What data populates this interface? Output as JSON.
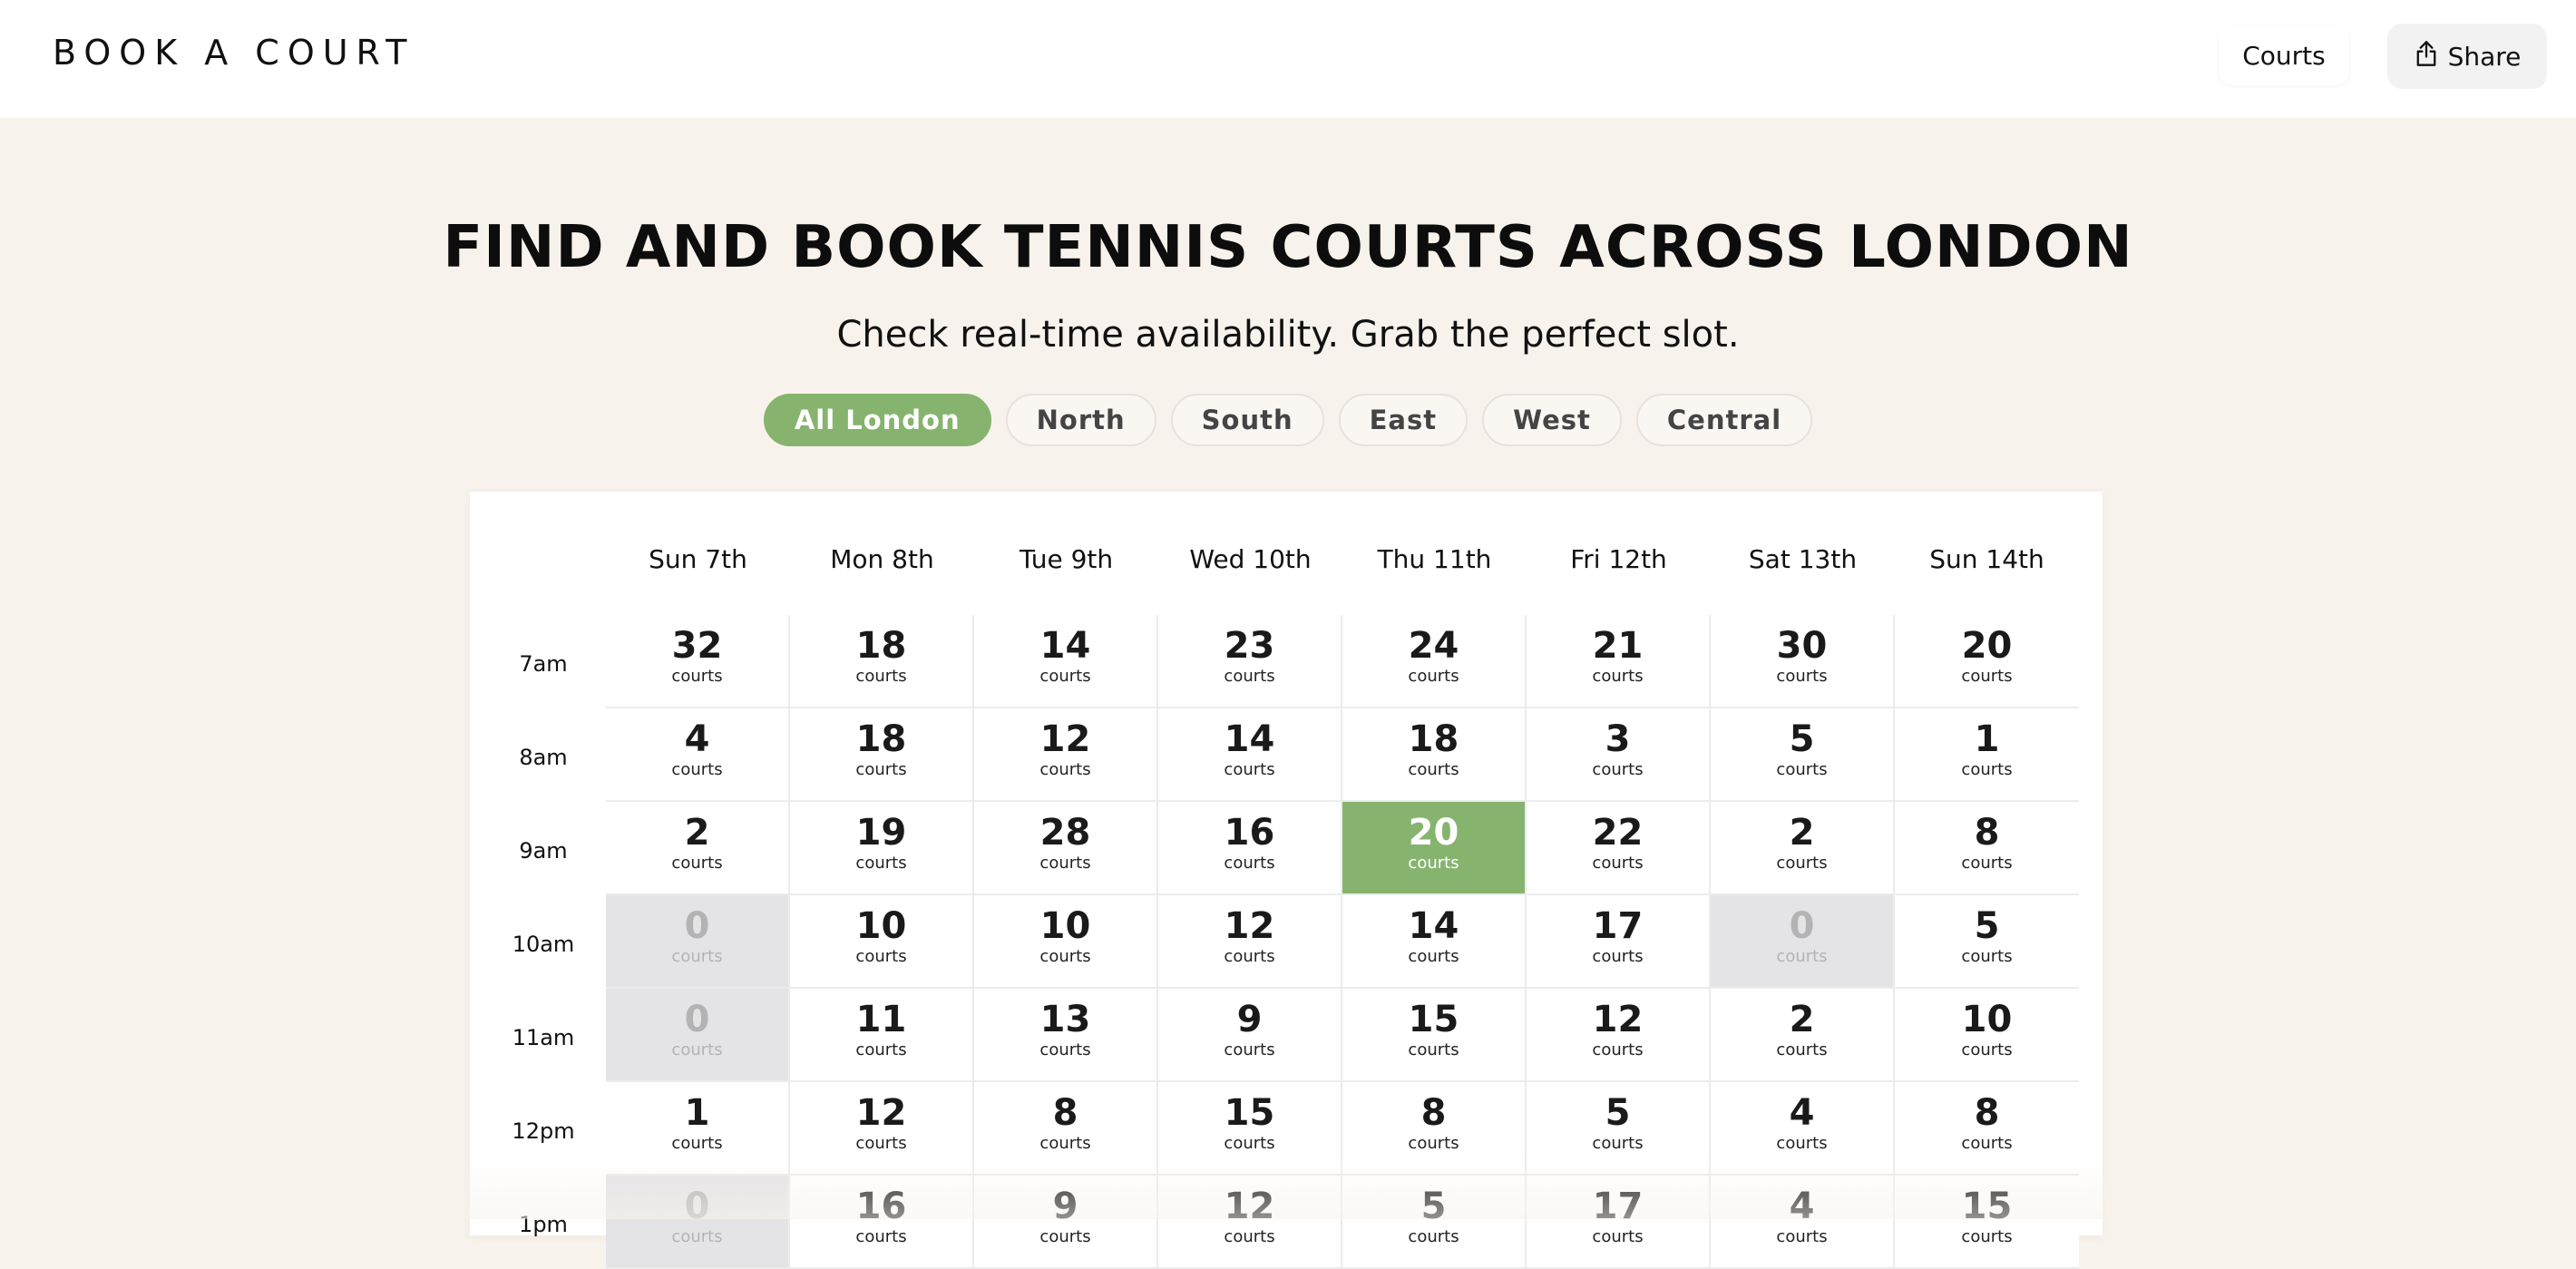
{
  "header": {
    "brand": "BOOK A COURT",
    "nav": {
      "courts_label": "Courts",
      "share_label": "Share"
    }
  },
  "hero": {
    "title": "FIND AND BOOK TENNIS COURTS ACROSS LONDON",
    "subtitle": "Check real-time availability. Grab the perfect slot."
  },
  "filters": {
    "items": [
      "All London",
      "North",
      "South",
      "East",
      "West",
      "Central"
    ],
    "active": "All London"
  },
  "schedule": {
    "days": [
      "Sun 7th",
      "Mon 8th",
      "Tue 9th",
      "Wed 10th",
      "Thu 11th",
      "Fri 12th",
      "Sat 13th",
      "Sun 14th"
    ],
    "unit_label": "courts",
    "selected": {
      "time": "9am",
      "day": "Thu 11th"
    },
    "rows": [
      {
        "time": "7am",
        "counts": [
          32,
          18,
          14,
          23,
          24,
          21,
          30,
          20
        ]
      },
      {
        "time": "8am",
        "counts": [
          4,
          18,
          12,
          14,
          18,
          3,
          5,
          1
        ]
      },
      {
        "time": "9am",
        "counts": [
          2,
          19,
          28,
          16,
          20,
          22,
          2,
          8
        ]
      },
      {
        "time": "10am",
        "counts": [
          0,
          10,
          10,
          12,
          14,
          17,
          0,
          5
        ]
      },
      {
        "time": "11am",
        "counts": [
          0,
          11,
          13,
          9,
          15,
          12,
          2,
          10
        ]
      },
      {
        "time": "12pm",
        "counts": [
          1,
          12,
          8,
          15,
          8,
          5,
          4,
          8
        ]
      },
      {
        "time": "1pm",
        "counts": [
          0,
          16,
          9,
          12,
          5,
          17,
          4,
          15
        ]
      }
    ]
  },
  "colors": {
    "accent": "#86b46f",
    "page_background": "#f8f2ec",
    "unavailable": "#e4e4e6"
  }
}
